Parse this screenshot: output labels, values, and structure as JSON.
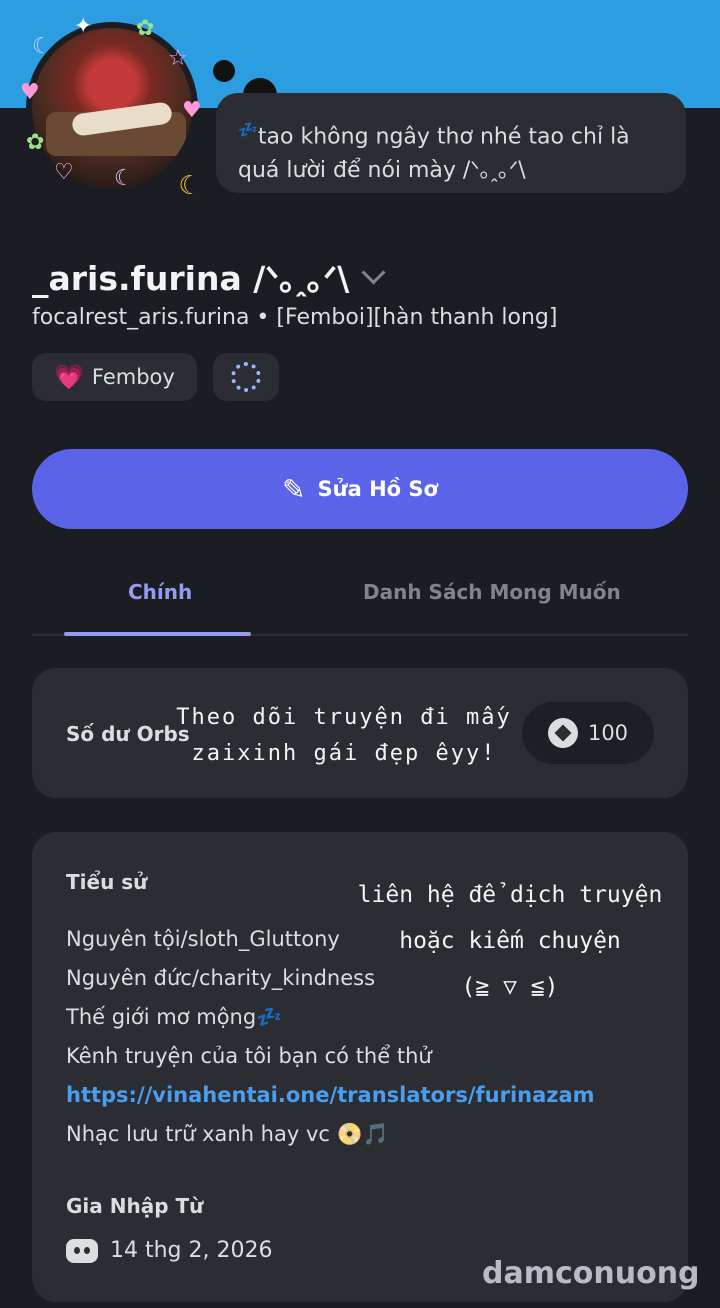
{
  "status_message": {
    "emoji": "💤",
    "text": "tao không ngây thơ nhé tao chỉ là quá lười để nói mày /ᐠ｡ꞈ｡ᐟ\\"
  },
  "profile": {
    "display_name": "_aris.furina /ᐠ｡ꞈ｡ᐟ\\",
    "handle": "focalrest_aris.furina • [Femboi][hàn thanh long]",
    "chips": [
      {
        "label": "Femboy",
        "emoji": "💗"
      }
    ]
  },
  "edit_button": {
    "label": "Sửa Hồ Sơ"
  },
  "tabs": [
    {
      "label": "Chính",
      "active": true
    },
    {
      "label": "Danh Sách Mong Muốn",
      "active": false
    }
  ],
  "orbs": {
    "label": "Số dư Orbs",
    "overlay_note": "Theo dõi truyện đi mấy zaixinh gái đẹp êyy!",
    "balance": "100"
  },
  "bio": {
    "title": "Tiểu sử",
    "lines": [
      "Nguyên tội/sloth_Gluttony",
      "Nguyên đức/charity_kindness",
      "Thế giới mơ mộng💤",
      "Kênh truyện của tôi bạn có thể thử",
      "https://vinahentai.one/translators/furinazam",
      "Nhạc lưu trữ xanh hay vc 📀🎵"
    ],
    "overlay_note_lines": [
      "liên hệ để dịch truyện",
      "hoặc kiếm chuyện",
      "(≧ ▽ ≦)"
    ]
  },
  "joined": {
    "title": "Gia Nhập Từ",
    "date": "14 thg 2, 2026"
  },
  "watermark": "damconuong",
  "colors": {
    "banner": "#2c9de0",
    "accent": "#5b63e8",
    "link": "#4a9ef0",
    "background": "#1c1d23",
    "card": "#2b2d33"
  }
}
